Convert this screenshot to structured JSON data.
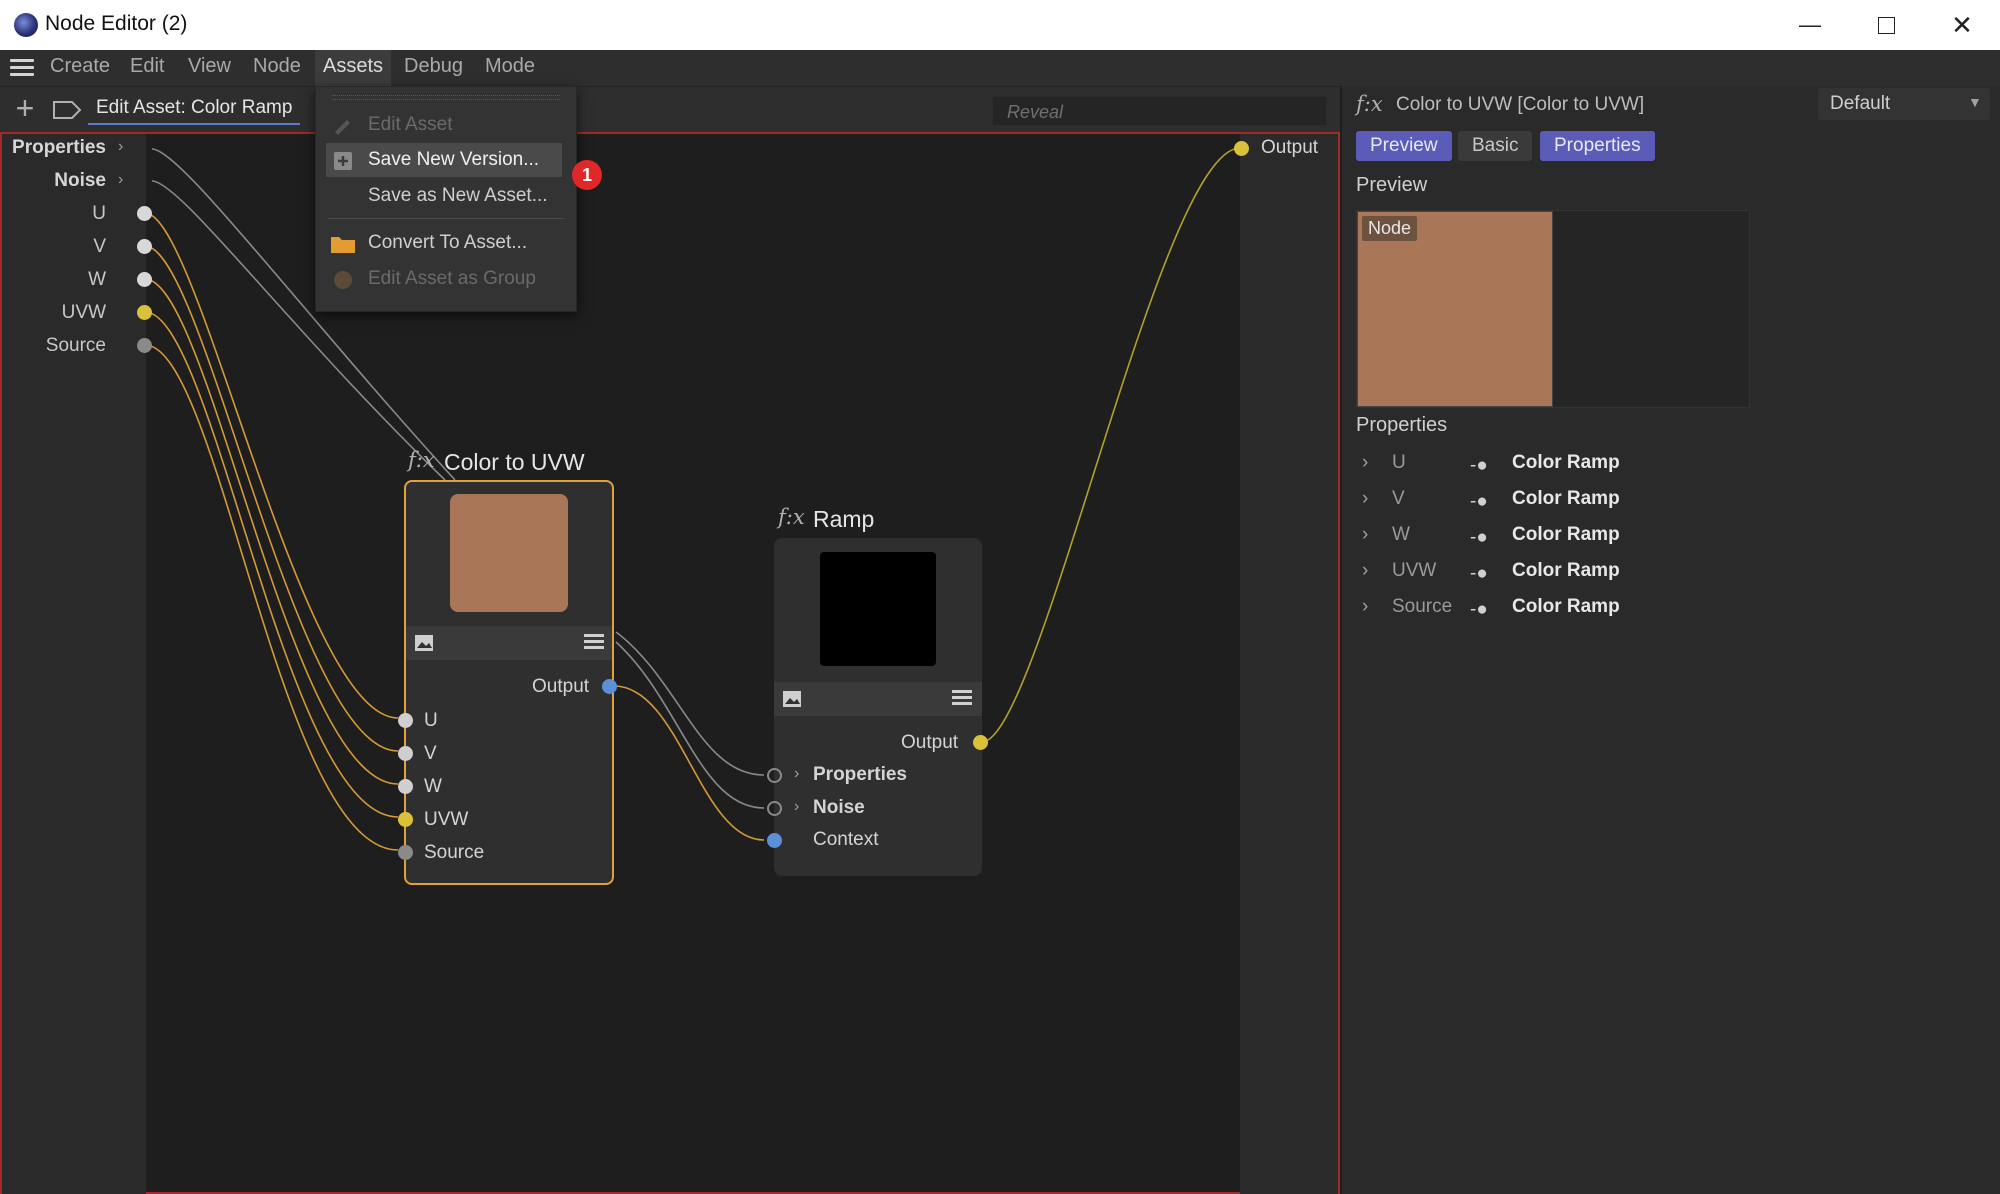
{
  "window": {
    "title": "Node Editor (2)"
  },
  "menubar": {
    "items": [
      "Create",
      "Edit",
      "View",
      "Node",
      "Assets",
      "Debug",
      "Mode"
    ]
  },
  "toolbar": {
    "edit_asset_label": "Edit Asset: Color Ramp",
    "reveal_placeholder": "Reveal"
  },
  "assets_menu": {
    "items": [
      {
        "label": "Edit Asset",
        "state": "disabled",
        "icon": "pencil-icon"
      },
      {
        "label": "Save New Version...",
        "state": "highlighted",
        "icon": "save-icon"
      },
      {
        "label": "Save as New Asset...",
        "state": "normal",
        "icon": ""
      },
      {
        "label": "Convert To Asset...",
        "state": "normal",
        "icon": "folder-icon"
      },
      {
        "label": "Edit Asset as Group",
        "state": "disabled",
        "icon": "group-icon"
      }
    ],
    "badge": "1"
  },
  "left_ports": [
    {
      "label": "Properties",
      "bold": true,
      "chevron": true
    },
    {
      "label": "Noise",
      "bold": true,
      "chevron": true
    },
    {
      "label": "U",
      "dot": "white"
    },
    {
      "label": "V",
      "dot": "white"
    },
    {
      "label": "W",
      "dot": "white"
    },
    {
      "label": "UVW",
      "dot": "yellow"
    },
    {
      "label": "Source",
      "dot": "grey"
    }
  ],
  "right_port": {
    "label": "Output"
  },
  "node_color_to_uvw": {
    "fx": "f:x",
    "title": "Color to UVW",
    "swatch_color": "#a97657",
    "output_label": "Output",
    "inputs": [
      "U",
      "V",
      "W",
      "UVW",
      "Source"
    ]
  },
  "node_ramp": {
    "fx": "f:x",
    "title": "Ramp",
    "swatch_color": "#000000",
    "output_label": "Output",
    "inputs": [
      "Properties",
      "Noise",
      "Context"
    ]
  },
  "panel": {
    "fx": "f:x",
    "title": "Color to UVW [Color to UVW]",
    "layout_select": "Default",
    "tabs": [
      {
        "label": "Preview",
        "active": true
      },
      {
        "label": "Basic",
        "active": false
      },
      {
        "label": "Properties",
        "active": true
      }
    ],
    "preview_heading": "Preview",
    "preview_tag": "Node",
    "preview_color": "#a97657",
    "properties_heading": "Properties",
    "properties": [
      {
        "name": "U",
        "value": "Color Ramp"
      },
      {
        "name": "V",
        "value": "Color Ramp"
      },
      {
        "name": "W",
        "value": "Color Ramp"
      },
      {
        "name": "UVW",
        "value": "Color Ramp"
      },
      {
        "name": "Source",
        "value": "Color Ramp"
      }
    ]
  },
  "colors": {
    "accent_selection": "#e2a23b",
    "tab_active": "#5a5cb8",
    "canvas_border": "#a12a2a",
    "badge": "#e02828"
  }
}
